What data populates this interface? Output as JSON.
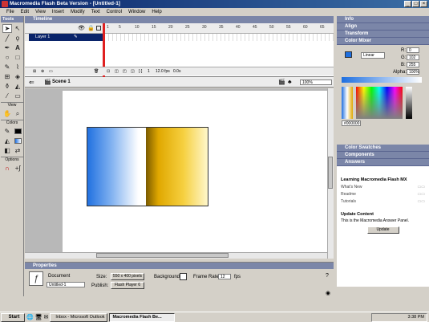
{
  "window": {
    "title": "Macromedia Flash Beta Version - [Untitled-1]",
    "buttons": [
      "_",
      "□",
      "×"
    ]
  },
  "menu": [
    "File",
    "Edit",
    "View",
    "Insert",
    "Modify",
    "Text",
    "Control",
    "Window",
    "Help"
  ],
  "tools": {
    "header": "Tools",
    "view_label": "View",
    "colors_label": "Colors",
    "options_label": "Options"
  },
  "timeline": {
    "header": "Timeline",
    "layer_name": "Layer 1",
    "frame_numbers": [
      "1",
      "5",
      "10",
      "15",
      "20",
      "25",
      "30",
      "35",
      "40",
      "45",
      "50",
      "55",
      "60",
      "65"
    ],
    "current_frame": "1",
    "frame_rate": "12.0 fps",
    "elapsed": "0.0s"
  },
  "scene": {
    "label": "Scene 1",
    "zoom": "100%"
  },
  "properties": {
    "header": "Properties",
    "doc_label": "Document",
    "doc_name": "Untitled-1",
    "size_label": "Size:",
    "size_value": "550 x 400 pixels",
    "background_label": "Background:",
    "frame_rate_label": "Frame Rate:",
    "frame_rate_value": "12",
    "fps_label": "fps",
    "publish_label": "Publish:",
    "publish_value": "Flash Player 6"
  },
  "panels": {
    "info": "Info",
    "align": "Align",
    "transform": "Transform",
    "color_mixer": "Color Mixer",
    "color_swatches": "Color Swatches",
    "components": "Components",
    "answers": "Answers"
  },
  "mixer": {
    "type": "Linear",
    "r_label": "R:",
    "r": "0",
    "g_label": "G:",
    "g": "102",
    "b_label": "B:",
    "b": "255",
    "alpha_label": "Alpha:",
    "alpha": "100%",
    "hex": "#000000"
  },
  "answers": {
    "learning_title": "Learning Macromedia Flash MX",
    "items": [
      "What's New",
      "Readme",
      "Tutorials"
    ],
    "update_title": "Update Content",
    "update_text": "This is the Macromedia Answer Panel.",
    "update_button": "Update"
  },
  "taskbar": {
    "start": "Start",
    "tasks": [
      "Inbox - Microsoft Outlook",
      "Macromedia Flash Be..."
    ],
    "clock": "3:38 PM"
  },
  "colors": {
    "accent": "#0a246a",
    "panel_header": "#7b86a8",
    "playhead": "#e02020"
  }
}
